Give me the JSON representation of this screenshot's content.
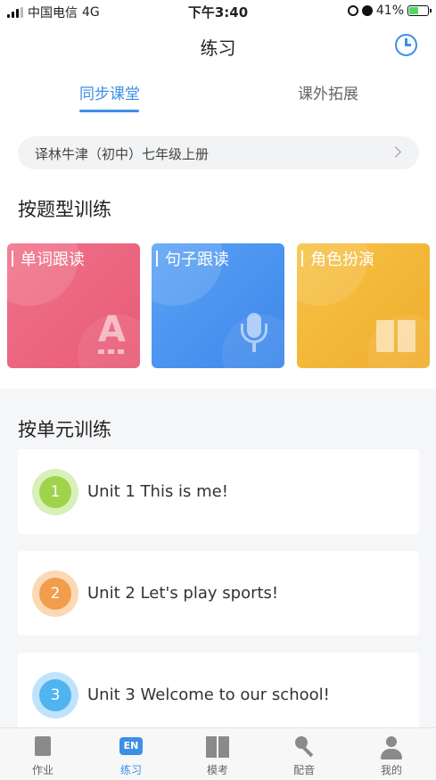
{
  "status_bar": {
    "carrier": "中国电信",
    "network": "4G",
    "time": "下午3:40",
    "battery": "41%"
  },
  "nav": {
    "title": "练习",
    "history_icon": "clock-icon"
  },
  "tabs": [
    {
      "label": "同步课堂",
      "active": true
    },
    {
      "label": "课外拓展",
      "active": false
    }
  ],
  "book_selector": {
    "label": "译林牛津（初中）七年级上册",
    "icon": "chevron-right-icon"
  },
  "by_type": {
    "title": "按题型训练",
    "cards": [
      {
        "label": "单词跟读",
        "icon": "letter-a-icon",
        "color": "#ec6680"
      },
      {
        "label": "句子跟读",
        "icon": "microphone-icon",
        "color": "#4a93ef"
      },
      {
        "label": "角色扮演",
        "icon": "open-book-icon",
        "color": "#f3b73a"
      }
    ]
  },
  "by_unit": {
    "title": "按单元训练",
    "units": [
      {
        "number": "1",
        "title": "Unit 1 This is me!",
        "color": "#9fd34a"
      },
      {
        "number": "2",
        "title": "Unit 2 Let's play sports!",
        "color": "#f19d4b"
      },
      {
        "number": "3",
        "title": "Unit 3 Welcome to our school!",
        "color": "#4fb4ef"
      }
    ]
  },
  "tab_bar": {
    "items": [
      {
        "label": "作业",
        "icon": "homework-icon",
        "active": false
      },
      {
        "label": "练习",
        "icon": "en-icon",
        "icon_text": "EN",
        "active": true
      },
      {
        "label": "模考",
        "icon": "book-icon",
        "active": false
      },
      {
        "label": "配音",
        "icon": "microphone-icon",
        "active": false
      },
      {
        "label": "我的",
        "icon": "user-icon",
        "active": false
      }
    ]
  },
  "colors": {
    "accent": "#3d8fe6",
    "background": "#f5f6f8"
  }
}
